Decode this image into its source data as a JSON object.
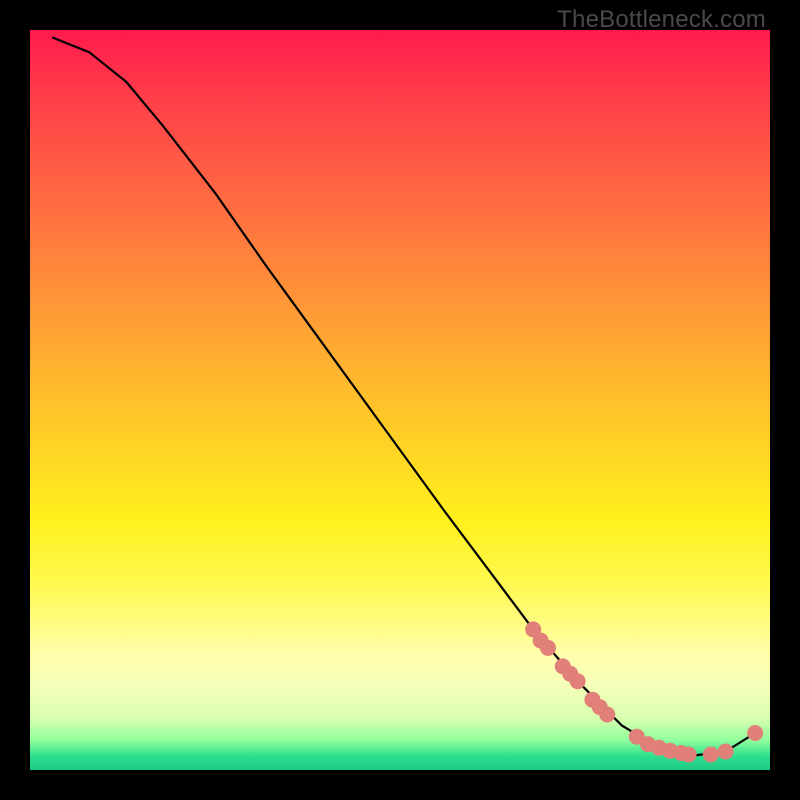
{
  "watermark": "TheBottleneck.com",
  "colors": {
    "curve_stroke": "#000000",
    "marker_fill": "#e08078",
    "marker_stroke": "#c86a62"
  },
  "chart_data": {
    "type": "line",
    "title": "",
    "xlabel": "",
    "ylabel": "",
    "xlim": [
      0,
      100
    ],
    "ylim": [
      0,
      100
    ],
    "curve": [
      {
        "x": 3,
        "y": 99
      },
      {
        "x": 8,
        "y": 97
      },
      {
        "x": 13,
        "y": 93
      },
      {
        "x": 18,
        "y": 87
      },
      {
        "x": 25,
        "y": 78
      },
      {
        "x": 32,
        "y": 68
      },
      {
        "x": 40,
        "y": 57
      },
      {
        "x": 48,
        "y": 46
      },
      {
        "x": 56,
        "y": 35
      },
      {
        "x": 62,
        "y": 27
      },
      {
        "x": 68,
        "y": 19
      },
      {
        "x": 74,
        "y": 12
      },
      {
        "x": 80,
        "y": 6
      },
      {
        "x": 85,
        "y": 3
      },
      {
        "x": 90,
        "y": 2
      },
      {
        "x": 94,
        "y": 2.5
      },
      {
        "x": 98,
        "y": 5
      }
    ],
    "markers": [
      {
        "x": 68,
        "y": 19
      },
      {
        "x": 69,
        "y": 17.5
      },
      {
        "x": 70,
        "y": 16.5
      },
      {
        "x": 72,
        "y": 14
      },
      {
        "x": 73,
        "y": 13
      },
      {
        "x": 74,
        "y": 12
      },
      {
        "x": 76,
        "y": 9.5
      },
      {
        "x": 77,
        "y": 8.5
      },
      {
        "x": 78,
        "y": 7.5
      },
      {
        "x": 82,
        "y": 4.5
      },
      {
        "x": 83.5,
        "y": 3.5
      },
      {
        "x": 85,
        "y": 3
      },
      {
        "x": 86.5,
        "y": 2.6
      },
      {
        "x": 88,
        "y": 2.3
      },
      {
        "x": 89,
        "y": 2.1
      },
      {
        "x": 92,
        "y": 2.1
      },
      {
        "x": 94,
        "y": 2.5
      },
      {
        "x": 98,
        "y": 5
      }
    ]
  }
}
